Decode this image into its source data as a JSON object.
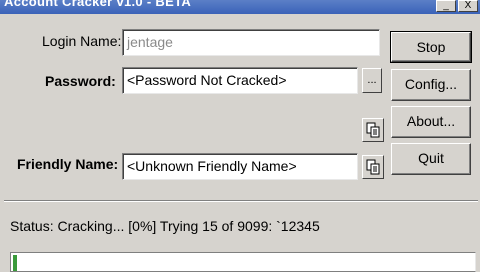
{
  "window": {
    "title": "Account Cracker v1.0 - BETA",
    "controls": [
      "_",
      "X"
    ]
  },
  "form": {
    "login_label": "Login Name:",
    "login_value": "jentage",
    "password_label": "Password:",
    "password_value": "<Password Not Cracked>",
    "browse_label": "...",
    "friendly_label": "Friendly Name:",
    "friendly_value": "<Unknown Friendly Name>"
  },
  "buttons": {
    "stop": "Stop",
    "config": "Config...",
    "about": "About...",
    "quit": "Quit"
  },
  "icons": {
    "copy_password": "copy-icon",
    "copy_friendly": "copy-icon"
  },
  "status": {
    "text": "Status:  Cracking... [0%] Trying 15 of 9099: `12345",
    "progress": 0.0
  }
}
